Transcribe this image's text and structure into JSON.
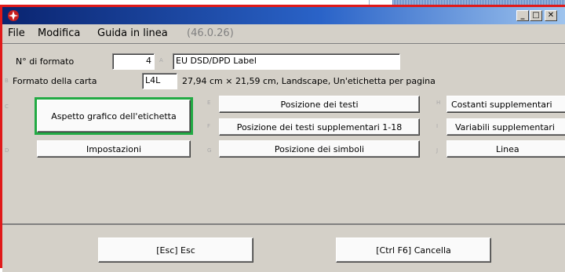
{
  "menu": {
    "file": "File",
    "modifica": "Modifica",
    "guida": "Guida in linea",
    "version": "(46.0.26)"
  },
  "form": {
    "num_label": "N° di formato",
    "num_value": "4",
    "name_value": "EU DSD/DPD Label",
    "paper_label": "Formato della carta",
    "paper_value": "L4L",
    "paper_desc": "27,94 cm × 21,59 cm, Landscape, Un'etichetta per pagina",
    "key_a": "A",
    "key_b": "B"
  },
  "buttons": {
    "aspetto": {
      "key": "C",
      "label": "Aspetto grafico dell'etichetta"
    },
    "impostazioni": {
      "key": "D",
      "label": "Impostazioni"
    },
    "pos_testi": {
      "key": "E",
      "label": "Posizione dei testi"
    },
    "pos_testi_supp": {
      "key": "F",
      "label": "Posizione dei testi supplementari 1-18"
    },
    "pos_simboli": {
      "key": "G",
      "label": "Posizione dei simboli"
    },
    "costanti": {
      "key": "H",
      "label": "Costanti supplementari"
    },
    "variabili": {
      "key": "I",
      "label": "Variabili supplementari"
    },
    "linea": {
      "key": "J",
      "label": "Linea"
    }
  },
  "footer": {
    "esc": "[Esc] Esc",
    "cancel": "[Ctrl F6] Cancella"
  },
  "colors": {
    "window_border": "#e01a1a",
    "title_start": "#0a2470",
    "title_end": "#a6caf0",
    "selected_outline": "#22aa44"
  }
}
